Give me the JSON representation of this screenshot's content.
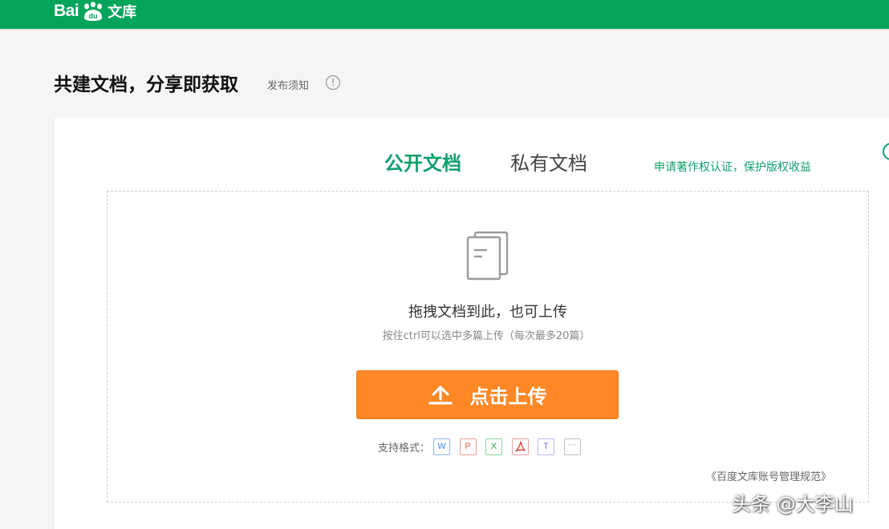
{
  "header": {
    "logo_prefix": "Bai",
    "logo_suffix": "文库"
  },
  "page": {
    "title": "共建文档，分享即获取",
    "notice_link": "发布须知",
    "notice_icon": "!"
  },
  "tabs": [
    {
      "label": "公开文档",
      "active": true
    },
    {
      "label": "私有文档",
      "active": false
    }
  ],
  "copyright_link": "申请著作权认证，保护版权收益",
  "dropzone": {
    "title": "拖拽文档到此，也可上传",
    "hint": "按住ctrl可以选中多篇上传（每次最多20篇）"
  },
  "upload_button": {
    "label": "点击上传"
  },
  "formats": {
    "label": "支持格式：",
    "items": [
      {
        "glyph": "W",
        "icon": "word-icon"
      },
      {
        "glyph": "P",
        "icon": "ppt-icon"
      },
      {
        "glyph": "X",
        "icon": "excel-icon"
      },
      {
        "glyph": "",
        "icon": "pdf-icon"
      },
      {
        "glyph": "T",
        "icon": "txt-icon"
      },
      {
        "glyph": "···",
        "icon": "more-icon"
      }
    ]
  },
  "rules_link": "《百度文库账号管理规范》",
  "watermark": "头条 @大李山",
  "colors": {
    "brand_green": "#05a45b",
    "accent_green": "#11a06a",
    "upload_orange": "#fd8825"
  }
}
